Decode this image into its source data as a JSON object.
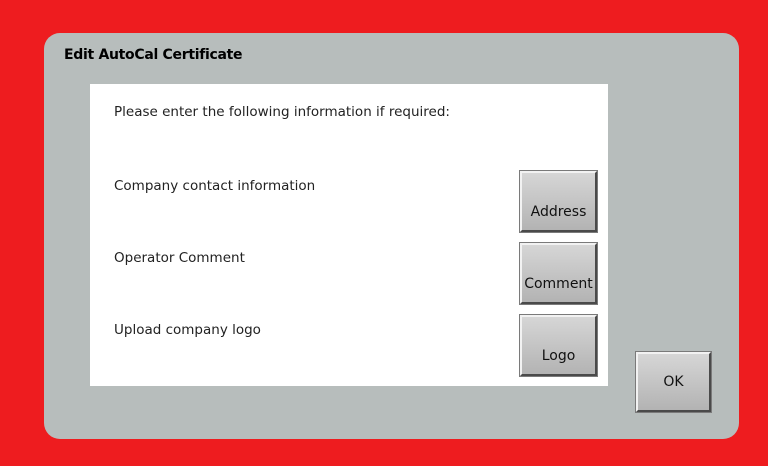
{
  "dialog": {
    "title": "Edit AutoCal Certificate",
    "instructions": "Please enter the following information if required:",
    "rows": [
      {
        "label": "Company contact information",
        "button": "Address"
      },
      {
        "label": "Operator Comment",
        "button": "Comment"
      },
      {
        "label": "Upload company logo",
        "button": "Logo"
      }
    ],
    "ok_label": "OK"
  },
  "colors": {
    "background": "#ee1c1f",
    "dialog": "#b7bdbc",
    "panel": "#ffffff"
  }
}
